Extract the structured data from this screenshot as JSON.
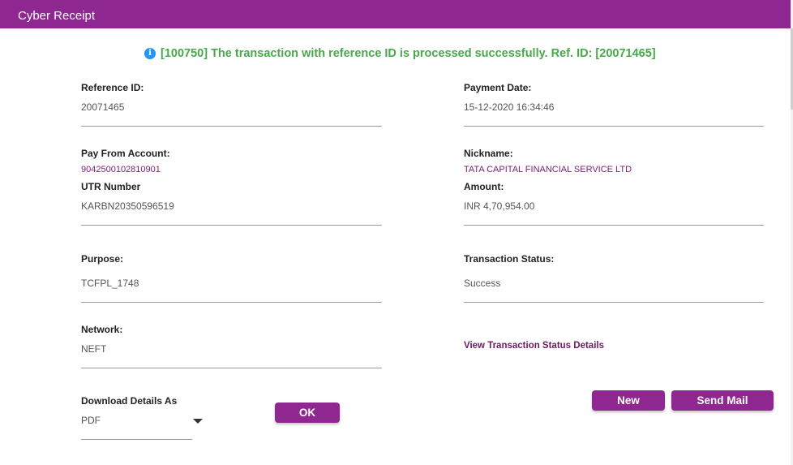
{
  "window": {
    "title": "Cyber Receipt"
  },
  "banner": {
    "icon": "info-icon",
    "message": "[100750] The transaction with reference ID is processed successfully. Ref. ID: [20071465]"
  },
  "fields": {
    "reference_id": {
      "label": "Reference ID:",
      "value": "20071465"
    },
    "payment_date": {
      "label": "Payment Date:",
      "value": "15-12-2020 16:34:46"
    },
    "pay_from_account": {
      "label": "Pay From Account:",
      "value": "9042500102810901"
    },
    "nickname": {
      "label": "Nickname:",
      "value": "TATA CAPITAL FINANCIAL SERVICE LTD"
    },
    "utr_number": {
      "label": "UTR Number",
      "value": "KARBN20350596519"
    },
    "amount": {
      "label": "Amount:",
      "value": "INR 4,70,954.00"
    },
    "purpose": {
      "label": "Purpose:",
      "value": "TCFPL_1748"
    },
    "transaction_status": {
      "label": "Transaction Status:",
      "value": "Success"
    },
    "network": {
      "label": "Network:",
      "value": "NEFT"
    }
  },
  "links": {
    "view_status": "View Transaction Status Details"
  },
  "download": {
    "label": "Download Details As",
    "selected": "PDF",
    "ok_label": "OK"
  },
  "actions": {
    "new_label": "New",
    "send_mail_label": "Send Mail"
  },
  "colors": {
    "brand": "#8e2790",
    "success": "#47a94a",
    "info": "#2196f3",
    "accent_text": "#7a1f6e"
  }
}
